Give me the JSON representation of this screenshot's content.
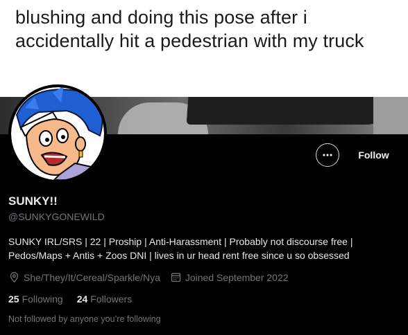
{
  "banner": {
    "caption": "blushing and doing this pose after i accidentally hit a pedestrian with my truck"
  },
  "profile": {
    "display_name": "SUNKY!!",
    "handle": "@SUNKYGONEWILD",
    "bio": "SUNKY IRL/SRS | 22 | Proship | Anti-Harassment | Probably not discourse free | Pedos/Maps + Antis + Zoos DNI | lives in ur head rent free since u so obsessed",
    "location": "She/They/It/Cereal/Sparkle/Nya",
    "joined": "Joined September 2022",
    "following_count": "25",
    "following_label": "Following",
    "followers_count": "24",
    "followers_label": "Followers",
    "not_followed_text": "Not followed by anyone you’re following"
  },
  "actions": {
    "more_icon": "···",
    "follow_label": "Follow"
  },
  "icons": {
    "location": "location-pin-icon",
    "calendar": "calendar-icon",
    "more": "more-horizontal-icon"
  },
  "colors": {
    "background": "#000000",
    "primary_text": "#e7e9ea",
    "secondary_text": "#71767b",
    "avatar_hair": "#1f5fd1"
  }
}
